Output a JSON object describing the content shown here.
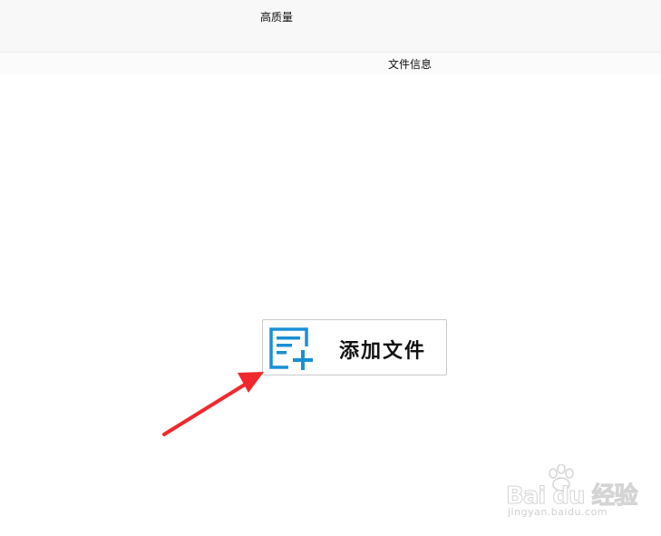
{
  "top_panel": {
    "quality_label": "高质量"
  },
  "file_list": {
    "header_label": "文件信息"
  },
  "add_file_button": {
    "label": "添加文件",
    "icon": "add-file-icon",
    "accent_color": "#1a8fd6"
  },
  "annotation": {
    "arrow_color": "#f0282d"
  },
  "watermark": {
    "brand": "Bai du 经验",
    "url": "jingyan.baidu.com"
  }
}
